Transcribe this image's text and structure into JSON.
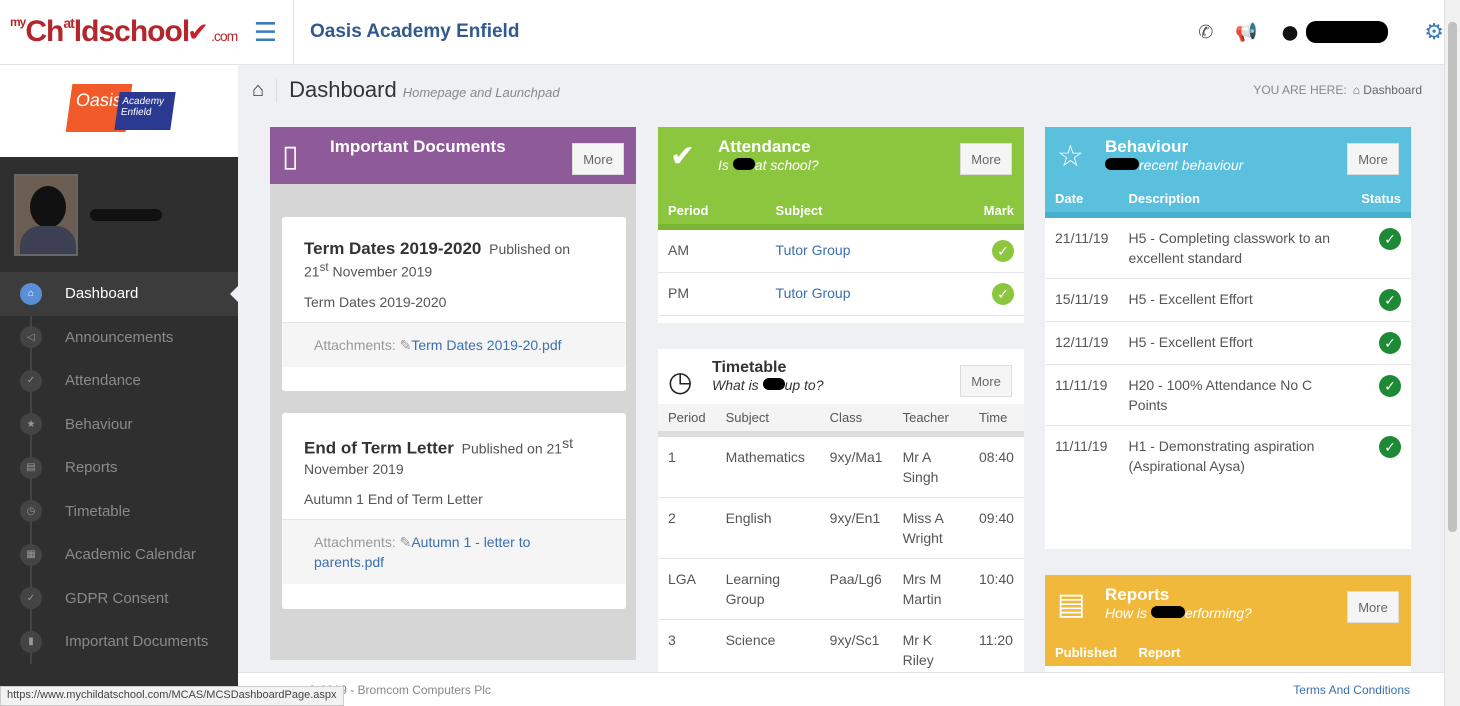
{
  "header": {
    "logo_my": "my",
    "logo_child": "Ch",
    "logo_ld": "ld",
    "logo_school": "school",
    "logo_com": ".com",
    "logo_at": "at",
    "school_name_bold": "Oasis Academy",
    "school_name_rest": "Enfield"
  },
  "sidebar": {
    "school_logo_text1": "Oasis",
    "school_logo_text2": "Academy Enfield",
    "items": [
      {
        "label": "Dashboard",
        "icon": "home-icon"
      },
      {
        "label": "Announcements",
        "icon": "megaphone-icon"
      },
      {
        "label": "Attendance",
        "icon": "check-icon"
      },
      {
        "label": "Behaviour",
        "icon": "star-icon"
      },
      {
        "label": "Reports",
        "icon": "document-icon"
      },
      {
        "label": "Timetable",
        "icon": "clock-icon"
      },
      {
        "label": "Academic Calendar",
        "icon": "calendar-icon"
      },
      {
        "label": "GDPR Consent",
        "icon": "check-icon"
      },
      {
        "label": "Important Documents",
        "icon": "file-icon"
      }
    ]
  },
  "page": {
    "title": "Dashboard",
    "subtitle": "Homepage and Launchpad",
    "crumb_label": "YOU ARE HERE:",
    "crumb_current": "Dashboard"
  },
  "documents": {
    "title": "Important Documents",
    "more": "More",
    "items": [
      {
        "title": "Term Dates 2019-2020",
        "published": "Published on",
        "date_day": "21",
        "date_sup": "st",
        "date_rest": "November 2019",
        "desc": "Term Dates 2019-2020",
        "att_label": "Attachments:",
        "att_file": "Term Dates 2019-20.pdf"
      },
      {
        "title": "End of Term Letter",
        "published": "Published on",
        "date_day": "21",
        "date_sup": "st",
        "date_rest": "November 2019",
        "desc": "Autumn 1 End of Term Letter",
        "att_label": "Attachments:",
        "att_file": "Autumn 1 - letter to parents.pdf"
      }
    ]
  },
  "attendance": {
    "title": "Attendance",
    "subtitle_a": "Is",
    "subtitle_b": "at school?",
    "more": "More",
    "columns": [
      "Period",
      "Subject",
      "Mark"
    ],
    "rows": [
      {
        "period": "AM",
        "subject": "Tutor Group"
      },
      {
        "period": "PM",
        "subject": "Tutor Group"
      }
    ]
  },
  "timetable": {
    "title": "Timetable",
    "subtitle_a": "What is",
    "subtitle_b": "up to?",
    "more": "More",
    "columns": [
      "Period",
      "Subject",
      "Class",
      "Teacher",
      "Time"
    ],
    "rows": [
      {
        "period": "1",
        "subject": "Mathematics",
        "class": "9xy/Ma1",
        "teacher": "Mr A Singh",
        "time": "08:40"
      },
      {
        "period": "2",
        "subject": "English",
        "class": "9xy/En1",
        "teacher": "Miss A Wright",
        "time": "09:40"
      },
      {
        "period": "LGA",
        "subject": "Learning Group",
        "class": "Paa/Lg6",
        "teacher": "Mrs M Martin",
        "time": "10:40"
      },
      {
        "period": "3",
        "subject": "Science",
        "class": "9xy/Sc1",
        "teacher": "Mr K Riley",
        "time": "11:20"
      }
    ]
  },
  "behaviour": {
    "title": "Behaviour",
    "subtitle": "recent behaviour",
    "more": "More",
    "columns": [
      "Date",
      "Description",
      "Status"
    ],
    "rows": [
      {
        "date": "21/11/19",
        "desc": "H5 - Completing classwork to an excellent standard"
      },
      {
        "date": "15/11/19",
        "desc": "H5 - Excellent Effort"
      },
      {
        "date": "12/11/19",
        "desc": "H5 - Excellent Effort"
      },
      {
        "date": "11/11/19",
        "desc": "H20 - 100% Attendance No C Points"
      },
      {
        "date": "11/11/19",
        "desc": "H1 - Demonstrating aspiration (Aspirational Aysa)"
      }
    ]
  },
  "reports": {
    "title": "Reports",
    "subtitle_a": "How is",
    "subtitle_b": "erforming?",
    "more": "More",
    "columns": [
      "Published",
      "Report"
    ]
  },
  "footer": {
    "copyright": "© 2019 - Bromcom Computers Plc",
    "terms": "Terms And Conditions"
  },
  "status_url": "https://www.mychildatschool.com/MCAS/MCSDashboardPage.aspx"
}
